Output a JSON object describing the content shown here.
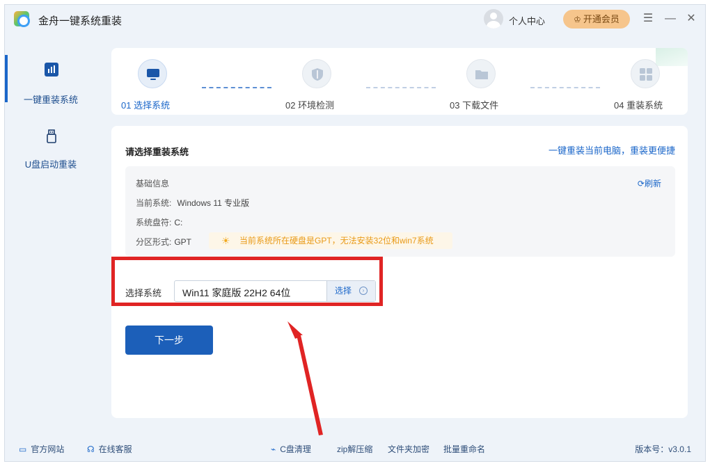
{
  "titlebar": {
    "app_title": "金舟一键系统重装",
    "user_center": "个人中心",
    "vip_label": "开通会员",
    "menu_icon": "menu-icon",
    "minimize_icon": "minimize-icon",
    "close_icon": "close-icon"
  },
  "sidebar": {
    "items": [
      {
        "label": "一键重装系统",
        "icon": "chart-bars-icon",
        "active": true
      },
      {
        "label": "U盘启动重装",
        "icon": "usb-drive-icon",
        "active": false
      }
    ]
  },
  "steps": [
    {
      "label": "01 选择系统",
      "icon": "monitor-icon",
      "active": true
    },
    {
      "label": "02 环境检测",
      "icon": "shield-icon",
      "active": false
    },
    {
      "label": "03 下载文件",
      "icon": "folder-icon",
      "active": false
    },
    {
      "label": "04 重装系统",
      "icon": "windows-icon",
      "active": false
    }
  ],
  "main": {
    "section_title": "请选择重装系统",
    "top_link": "一键重装当前电脑，重装更便捷",
    "info": {
      "title": "基础信息",
      "refresh": "刷新",
      "current_system_label": "当前系统:",
      "current_system_value": "Windows 11 专业版",
      "drive_label": "系统盘符:",
      "drive_value": "C:",
      "partition_label": "分区形式:",
      "partition_value": "GPT",
      "warning": "当前系统所在硬盘是GPT，无法安装32位和win7系统"
    },
    "select": {
      "label": "选择系统",
      "value": "Win11 家庭版 22H2 64位",
      "button": "选择"
    },
    "next_button": "下一步"
  },
  "footer": {
    "items": [
      {
        "label": "官方网站",
        "icon": "monitor-icon"
      },
      {
        "label": "在线客服",
        "icon": "headset-icon"
      }
    ],
    "tools": [
      {
        "label": "C盘清理",
        "icon": "broom-icon"
      },
      {
        "label": "zip解压缩"
      },
      {
        "label": "文件夹加密"
      },
      {
        "label": "批量重命名"
      }
    ],
    "version": "版本号：v3.0.1"
  },
  "colors": {
    "accent": "#1a66c9",
    "annotation_red": "#e02424",
    "warning": "#e99a17",
    "vip": "#f6c58c"
  }
}
